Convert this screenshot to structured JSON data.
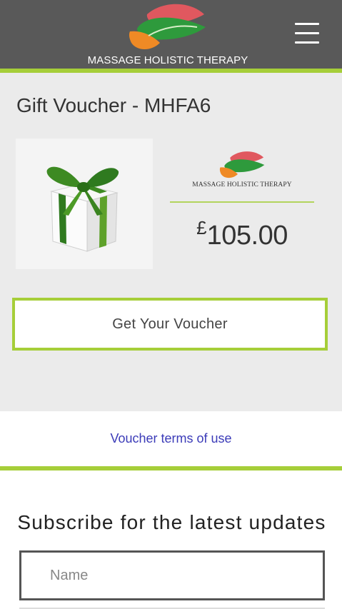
{
  "header": {
    "brand_name": "MASSAGE HOLISTIC THERAPY",
    "logo_icon": "three-leaves-logo",
    "menu_icon": "hamburger-menu-icon"
  },
  "product": {
    "title": "Gift Voucher - MHFA6",
    "image_icon": "gift-box-with-green-ribbon",
    "voucher_brand": "MASSAGE HOLISTIC THERAPY",
    "price_currency": "£",
    "price_amount": "105.00",
    "cta_label": "Get Your Voucher"
  },
  "terms": {
    "link_label": "Voucher terms of use"
  },
  "subscribe": {
    "title": "Subscribe for the latest updates",
    "name_placeholder": "Name",
    "name_value": ""
  },
  "colors": {
    "header_background": "#595959",
    "accent_green": "#a6ce39",
    "link_blue": "#3b3bb8",
    "leaf_red": "#e0585f",
    "leaf_green": "#2e9a3c",
    "leaf_orange": "#ef8a25"
  }
}
